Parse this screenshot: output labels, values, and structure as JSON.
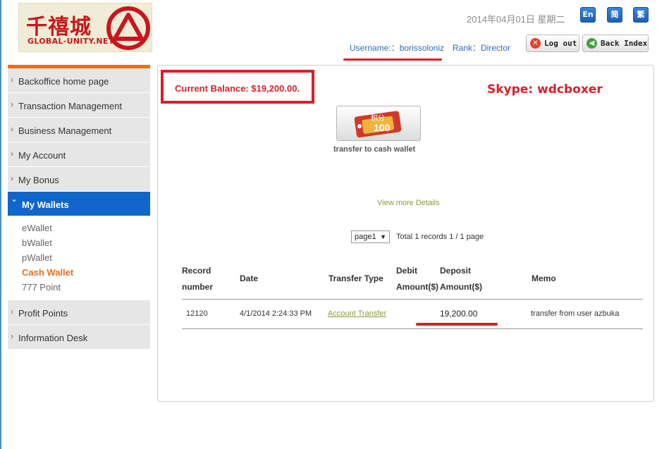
{
  "logo": {
    "chinese": "千禧城",
    "english": "GLOBAL-UNITY.NET"
  },
  "header": {
    "date": "2014年04月01日  星期二",
    "languages": [
      "En",
      "简",
      "繁"
    ],
    "username": "Username:：borissoloniz",
    "rank": "Rank：Director",
    "logout_label": "Log out",
    "back_label": "Back Index"
  },
  "sidebar": {
    "items_top": [
      "Backoffice home page",
      "Transaction Management",
      "Business Management",
      "My Account",
      "My Bonus"
    ],
    "active": "My Wallets",
    "sub_items": [
      "eWallet",
      "bWallet",
      "pWallet",
      "Cash Wallet",
      "777 Point"
    ],
    "items_bottom": [
      "Profit Points",
      "Information Desk"
    ]
  },
  "main": {
    "balance": "Current Balance: $19,200.00.",
    "skype": "Skype: wdcboxer",
    "coupon_text": "积分",
    "coupon_number": "100",
    "transfer_label": "transfer to cash wallet",
    "view_more": "View more Details",
    "page_select": "page1",
    "page_total": "Total 1 records 1 / 1 page"
  },
  "table": {
    "headers": {
      "record_1": "Record",
      "record_2": "number",
      "date": "Date",
      "type": "Transfer Type",
      "debit_1": "Debit",
      "debit_2": "Amount($)",
      "deposit_1": "Deposit",
      "deposit_2": "Amount($)",
      "memo": "Memo"
    },
    "rows": [
      {
        "record": "12120",
        "date": "4/1/2014 2:24:33 PM",
        "type": "Account Transfer",
        "debit": "",
        "deposit": "19,200.00",
        "memo": "transfer from user azbuka"
      }
    ]
  },
  "colors": {
    "accent_orange": "#e86e1c",
    "active_blue": "#1166cc",
    "highlight_red": "#d8202a",
    "link_olive": "#8a9a3a"
  }
}
